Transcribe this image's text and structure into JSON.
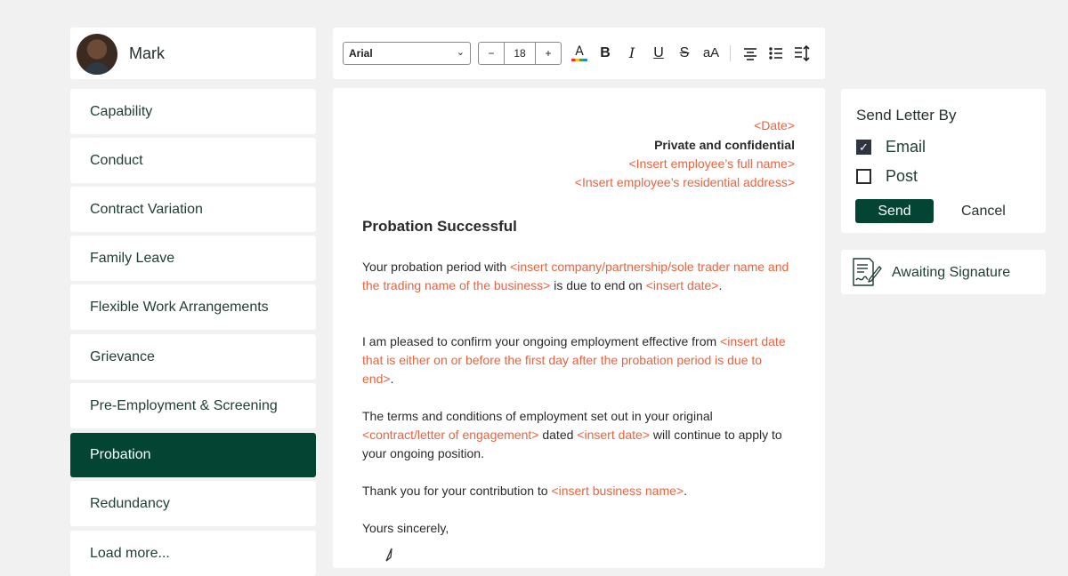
{
  "profile": {
    "name": "Mark"
  },
  "nav": {
    "items": [
      {
        "label": "Capability",
        "active": false
      },
      {
        "label": "Conduct",
        "active": false
      },
      {
        "label": "Contract Variation",
        "active": false
      },
      {
        "label": "Family Leave",
        "active": false
      },
      {
        "label": "Flexible Work Arrangements",
        "active": false
      },
      {
        "label": "Grievance",
        "active": false
      },
      {
        "label": "Pre-Employment & Screening",
        "active": false
      },
      {
        "label": "Probation",
        "active": true
      },
      {
        "label": "Redundancy",
        "active": false
      },
      {
        "label": "Load more...",
        "active": false
      }
    ]
  },
  "toolbar": {
    "font": "Arial",
    "font_size": "18",
    "minus": "−",
    "plus": "+",
    "icons": [
      "text-color-icon",
      "bold-icon",
      "italic-icon",
      "underline-icon",
      "strikethrough-icon",
      "change-case-icon",
      "align-center-icon",
      "bullet-list-icon",
      "line-spacing-icon"
    ]
  },
  "letter": {
    "date": "<Date>",
    "confidential": "Private and confidential",
    "employee_name": "<Insert employee’s full name>",
    "employee_address": "<Insert employee’s residential address>",
    "title": "Probation Successful",
    "p1_a": "Your probation period with ",
    "p1_b": "<insert company/partnership/sole trader name and the trading name of the business>",
    "p1_c": " is due to end on ",
    "p1_d": "<insert date>",
    "p1_e": ".",
    "p2_a": "I am pleased to confirm your ongoing employment effective from ",
    "p2_b": "<insert date that is either on or before the first day after the probation period is due to end>",
    "p2_c": ".",
    "p3_a": "The terms and conditions of employment set out in your original ",
    "p3_b": "<contract/letter of engagement>",
    "p3_c": " dated ",
    "p3_d": "<insert date>",
    "p3_e": " will continue to apply to your ongoing position.",
    "p4_a": "Thank you for your contribution to ",
    "p4_b": "<insert business name>",
    "p4_c": ".",
    "closing": "Yours sincerely,"
  },
  "send": {
    "title": "Send Letter By",
    "email_label": "Email",
    "email_checked": true,
    "post_label": "Post",
    "post_checked": false,
    "send_label": "Send",
    "cancel_label": "Cancel"
  },
  "status": {
    "label": "Awaiting Signature",
    "icon": "document-signature-icon"
  },
  "colors": {
    "brand": "#034433",
    "placeholder": "#e8633f",
    "background": "#f1f1f1"
  }
}
